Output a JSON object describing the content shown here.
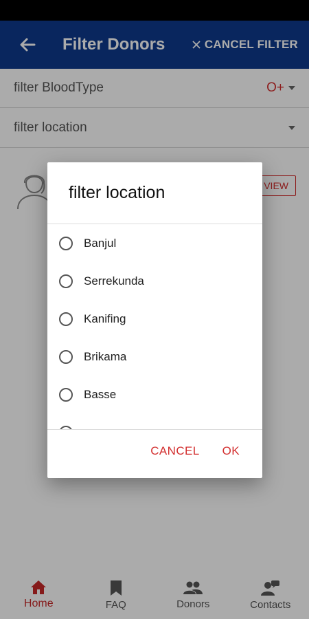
{
  "app_bar": {
    "title": "Filter Donors",
    "back_icon": "arrow-left-icon",
    "cancel_icon": "close-icon",
    "cancel_label": "CANCEL FILTER",
    "background": "#0e3a8c"
  },
  "filters": {
    "blood_type": {
      "label": "filter BloodType",
      "value": "O+"
    },
    "location": {
      "label": "filter location",
      "value": ""
    }
  },
  "donor_card": {
    "avatar_icon": "person-avatar-icon",
    "view_label": "VIEW"
  },
  "dialog": {
    "title": "filter location",
    "options": [
      {
        "label": "Banjul"
      },
      {
        "label": "Serrekunda"
      },
      {
        "label": "Kanifing"
      },
      {
        "label": "Brikama"
      },
      {
        "label": "Basse"
      }
    ],
    "cancel_label": "CANCEL",
    "ok_label": "OK"
  },
  "bottom_nav": {
    "items": [
      {
        "label": "Home",
        "icon": "home-icon",
        "active": true
      },
      {
        "label": "FAQ",
        "icon": "bookmark-icon",
        "active": false
      },
      {
        "label": "Donors",
        "icon": "people-icon",
        "active": false
      },
      {
        "label": "Contacts",
        "icon": "contacts-icon",
        "active": false
      }
    ]
  },
  "colors": {
    "accent": "#d32f2f",
    "primary": "#0e3a8c"
  }
}
